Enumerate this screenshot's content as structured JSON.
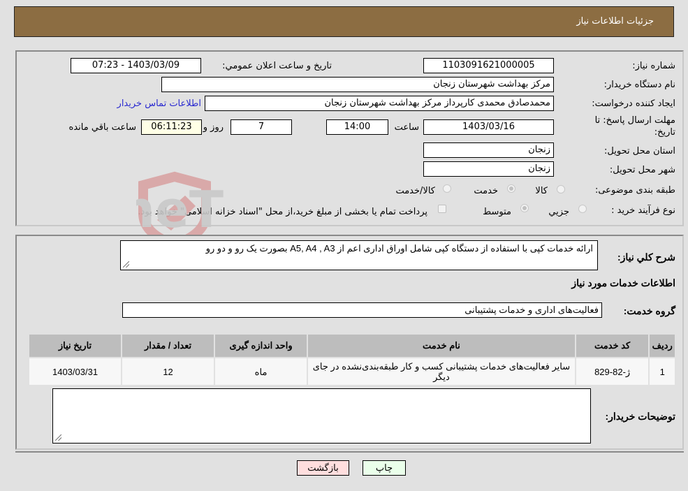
{
  "header": {
    "title": "جزئیات اطلاعات نیاز"
  },
  "details": {
    "need_number_label": "شماره نیاز:",
    "need_number": "1103091621000005",
    "announce_label": "تاریخ و ساعت اعلان عمومي:",
    "announce_value": "1403/03/09 - 07:23",
    "buyer_org_label": "نام دستگاه خریدار:",
    "buyer_org": "مرکز بهداشت شهرستان زنجان",
    "creator_label": "ایجاد کننده درخواست:",
    "creator": "محمدصادق محمدی کارپرداز مرکز بهداشت شهرستان زنجان",
    "contact_link": "اطلاعات تماس خریدار",
    "deadline_label_1": "مهلت ارسال پاسخ: تا",
    "deadline_label_2": "تاریخ:",
    "deadline_date": "1403/03/16",
    "time_label": "ساعت",
    "deadline_time": "14:00",
    "days_value": "7",
    "days_label": "روز و",
    "remaining_time": "06:11:23",
    "remaining_label": "ساعت باقي مانده",
    "province_label": "استان محل تحویل:",
    "province": "زنجان",
    "city_label": "شهر محل تحویل:",
    "city": "زنجان",
    "category_label": "طبقه بندی موضوعی:",
    "category_options": [
      "کالا",
      "خدمت",
      "کالا/خدمت"
    ],
    "category_selected": "خدمت",
    "process_label": "نوع فرآیند خرید :",
    "process_options": [
      "جزيي",
      "متوسط"
    ],
    "process_selected": "متوسط",
    "treasury_note": "پرداخت تمام یا بخشی از مبلغ خرید،از محل \"اسناد خزانه اسلامی\" خواهد بود."
  },
  "services": {
    "description_label": "شرح کلي نیاز:",
    "description": "ارائه خدمات کپی با استفاده از دستگاه کپی شامل اوراق اداری اعم از A5, A4 , A3 بصورت یک رو و دو رو",
    "section_title": "اطلاعات خدمات مورد نیاز",
    "group_label": "گروه خدمت:",
    "group_value": "فعالیت‌های اداری و خدمات پشتیبانی",
    "table": {
      "headers": [
        "ردیف",
        "کد خدمت",
        "نام خدمت",
        "واحد اندازه گیری",
        "تعداد / مقدار",
        "تاریخ نیاز"
      ],
      "rows": [
        [
          "1",
          "ژ-82-829",
          "سایر فعالیت‌های خدمات پشتیبانی کسب و کار طبقه‌بندی‌نشده در جای دیگر",
          "ماه",
          "12",
          "1403/03/31"
        ]
      ]
    },
    "buyer_notes_label": "توضیحات خریدار:",
    "buyer_notes": ""
  },
  "buttons": {
    "print": "چاپ",
    "back": "بازگشت"
  },
  "watermark": {
    "text": "AriaTender.neT"
  },
  "colors": {
    "header_bg": "#8c6d42",
    "print_bg": "#eaffea",
    "back_bg": "#ffdede",
    "link": "#2a2ad0"
  }
}
